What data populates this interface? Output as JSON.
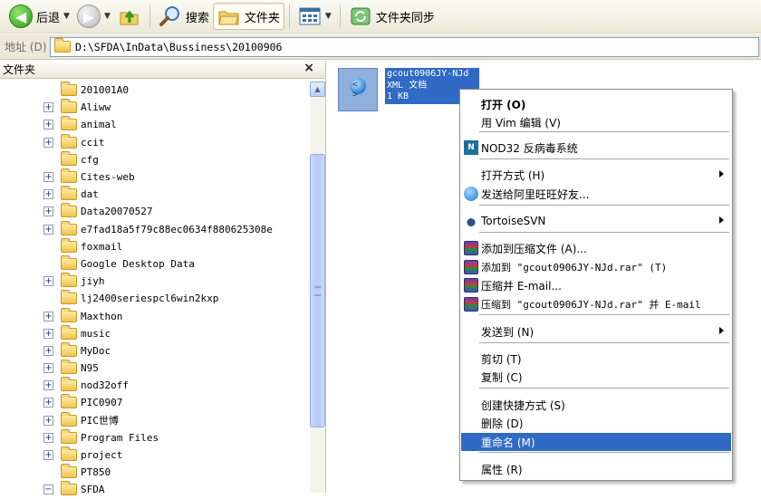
{
  "toolbar": {
    "back_label": "后退",
    "search_label": "搜索",
    "folders_label": "文件夹",
    "sync_label": "文件夹同步"
  },
  "address": {
    "label": "地址 (D)",
    "path": "D:\\SFDA\\InData\\Bussiness\\20100906"
  },
  "folder_pane": {
    "title": "文件夹",
    "close": "×",
    "items": [
      {
        "label": "201001A0",
        "expander": ""
      },
      {
        "label": "Aliww",
        "expander": "+"
      },
      {
        "label": "animal",
        "expander": "+"
      },
      {
        "label": "ccit",
        "expander": "+"
      },
      {
        "label": "cfg",
        "expander": ""
      },
      {
        "label": "Cites-web",
        "expander": "+"
      },
      {
        "label": "dat",
        "expander": "+"
      },
      {
        "label": "Data20070527",
        "expander": "+"
      },
      {
        "label": "e7fad18a5f79c88ec0634f880625308e",
        "expander": "+"
      },
      {
        "label": "foxmail",
        "expander": ""
      },
      {
        "label": "Google Desktop Data",
        "expander": ""
      },
      {
        "label": "jiyh",
        "expander": "+"
      },
      {
        "label": "lj2400seriespcl6win2kxp",
        "expander": ""
      },
      {
        "label": "Maxthon",
        "expander": "+"
      },
      {
        "label": "music",
        "expander": "+"
      },
      {
        "label": "MyDoc",
        "expander": "+"
      },
      {
        "label": "N95",
        "expander": "+"
      },
      {
        "label": "nod32off",
        "expander": "+"
      },
      {
        "label": "PIC0907",
        "expander": "+"
      },
      {
        "label": "PIC世博",
        "expander": "+"
      },
      {
        "label": "Program Files",
        "expander": "+"
      },
      {
        "label": "project",
        "expander": "+"
      },
      {
        "label": "PT850",
        "expander": ""
      },
      {
        "label": "SFDA",
        "expander": "−"
      }
    ]
  },
  "file": {
    "line1": "gcout0906JY-NJd",
    "line2": "XML 文档",
    "line3": "1 KB"
  },
  "context_menu": {
    "items": [
      {
        "text": "打开 (O)",
        "bold": true
      },
      {
        "text": "用 Vim 编辑 (V)"
      },
      {
        "text": "NOD32 反病毒系统",
        "icon": "nod32-icon"
      },
      {
        "text": "打开方式 (H)",
        "submenu": true
      },
      {
        "text": "发送给阿里旺旺好友...",
        "icon": "aliwangwang-icon"
      },
      {
        "text": "TortoiseSVN",
        "icon": "tortoisesvn-icon",
        "submenu": true
      },
      {
        "text": "添加到压缩文件 (A)...",
        "icon": "winrar-icon"
      },
      {
        "text": "添加到 \"gcout0906JY-NJd.rar\" (T)",
        "icon": "winrar-icon"
      },
      {
        "text": "压缩并 E-mail...",
        "icon": "winrar-icon"
      },
      {
        "text": "压缩到 \"gcout0906JY-NJd.rar\" 并 E-mail",
        "icon": "winrar-icon"
      },
      {
        "text": "发送到 (N)",
        "submenu": true
      },
      {
        "text": "剪切 (T)"
      },
      {
        "text": "复制 (C)"
      },
      {
        "text": "创建快捷方式 (S)"
      },
      {
        "text": "删除 (D)"
      },
      {
        "text": "重命名 (M)",
        "selected": true
      },
      {
        "text": "属性 (R)"
      }
    ]
  },
  "colors": {
    "selection": "#316ac5",
    "toolbar_bg": "#ece9d8"
  }
}
